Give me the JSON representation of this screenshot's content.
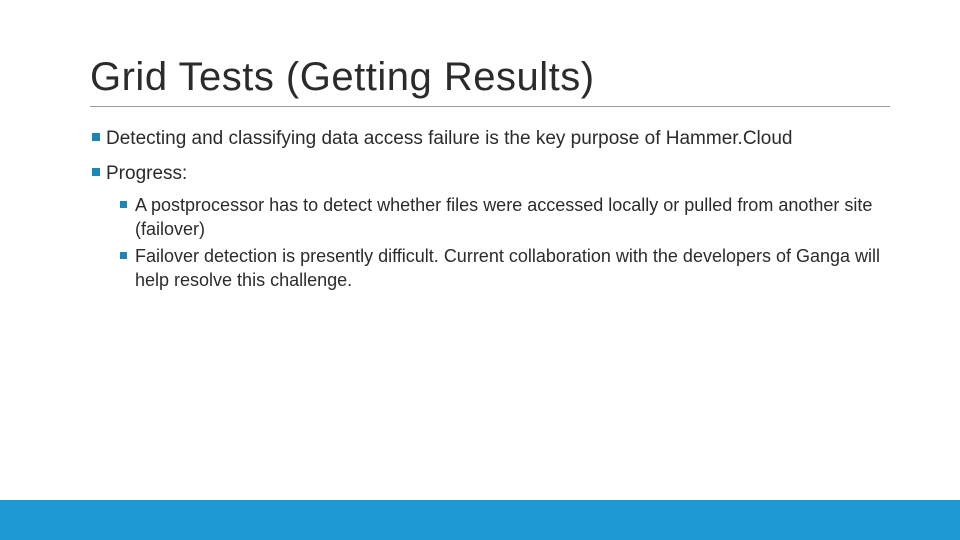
{
  "title": "Grid Tests (Getting Results)",
  "bullets": [
    "Detecting and classifying data access failure is the key purpose of Hammer.Cloud",
    "Progress:"
  ],
  "sub_bullets": [
    "A postprocessor has to detect whether files were accessed locally or pulled from another site (failover)",
    "Failover detection is presently difficult. Current collaboration with the developers of Ganga will help resolve this challenge."
  ],
  "colors": {
    "accent": "#1e99d1",
    "bullet": "#1c86b8",
    "text": "#2b2b2b"
  }
}
